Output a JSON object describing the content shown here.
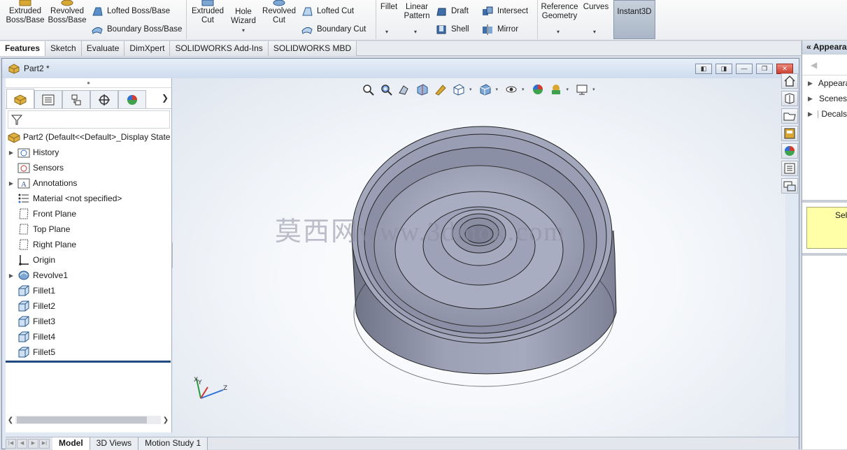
{
  "ribbon": {
    "extruded_boss": "Extruded\nBoss/Base",
    "revolved_boss": "Revolved\nBoss/Base",
    "lofted_boss": "Lofted Boss/Base",
    "boundary_boss": "Boundary Boss/Base",
    "extruded_cut": "Extruded\nCut",
    "hole_wizard": "Hole\nWizard",
    "revolved_cut": "Revolved\nCut",
    "lofted_cut": "Lofted Cut",
    "boundary_cut": "Boundary Cut",
    "fillet": "Fillet",
    "linear_pattern": "Linear\nPattern",
    "draft": "Draft",
    "shell": "Shell",
    "intersect": "Intersect",
    "mirror": "Mirror",
    "reference_geometry": "Reference\nGeometry",
    "curves": "Curves",
    "instant3d": "Instant3D"
  },
  "command_tabs": [
    "Features",
    "Sketch",
    "Evaluate",
    "DimXpert",
    "SOLIDWORKS Add-Ins",
    "SOLIDWORKS MBD"
  ],
  "document": {
    "title": "Part2 *"
  },
  "feature_tree": {
    "root": "Part2  (Default<<Default>_Display State",
    "items": [
      {
        "label": "History",
        "icon": "history-folder-icon",
        "expandable": true
      },
      {
        "label": "Sensors",
        "icon": "sensors-icon",
        "expandable": false
      },
      {
        "label": "Annotations",
        "icon": "annotations-icon",
        "expandable": true
      },
      {
        "label": "Material <not specified>",
        "icon": "material-icon",
        "expandable": false
      },
      {
        "label": "Front Plane",
        "icon": "plane-icon",
        "expandable": false
      },
      {
        "label": "Top Plane",
        "icon": "plane-icon",
        "expandable": false
      },
      {
        "label": "Right Plane",
        "icon": "plane-icon",
        "expandable": false
      },
      {
        "label": "Origin",
        "icon": "origin-icon",
        "expandable": false
      },
      {
        "label": "Revolve1",
        "icon": "revolve-icon",
        "expandable": true
      },
      {
        "label": "Fillet1",
        "icon": "fillet-icon",
        "expandable": false
      },
      {
        "label": "Fillet2",
        "icon": "fillet-icon",
        "expandable": false
      },
      {
        "label": "Fillet3",
        "icon": "fillet-icon",
        "expandable": false
      },
      {
        "label": "Fillet4",
        "icon": "fillet-icon",
        "expandable": false
      },
      {
        "label": "Fillet5",
        "icon": "fillet-icon",
        "expandable": false
      }
    ]
  },
  "graphics": {
    "watermark": "莫西网www.3dmox.com",
    "triad_axes": [
      "X",
      "Y",
      "Z"
    ]
  },
  "bottom_tabs": [
    "Model",
    "3D Views",
    "Motion Study 1"
  ],
  "task_pane": {
    "header": "Appearances",
    "items": [
      {
        "label": "Appearances",
        "icon": "appearances-icon"
      },
      {
        "label": "Scenes",
        "icon": "scenes-icon"
      },
      {
        "label": "Decals",
        "icon": "decals-icon"
      }
    ],
    "select_hint": "Select"
  },
  "colors": {
    "accent": "#21497f",
    "part_body": "#8f93a8",
    "select_bg": "#ffffa8"
  }
}
